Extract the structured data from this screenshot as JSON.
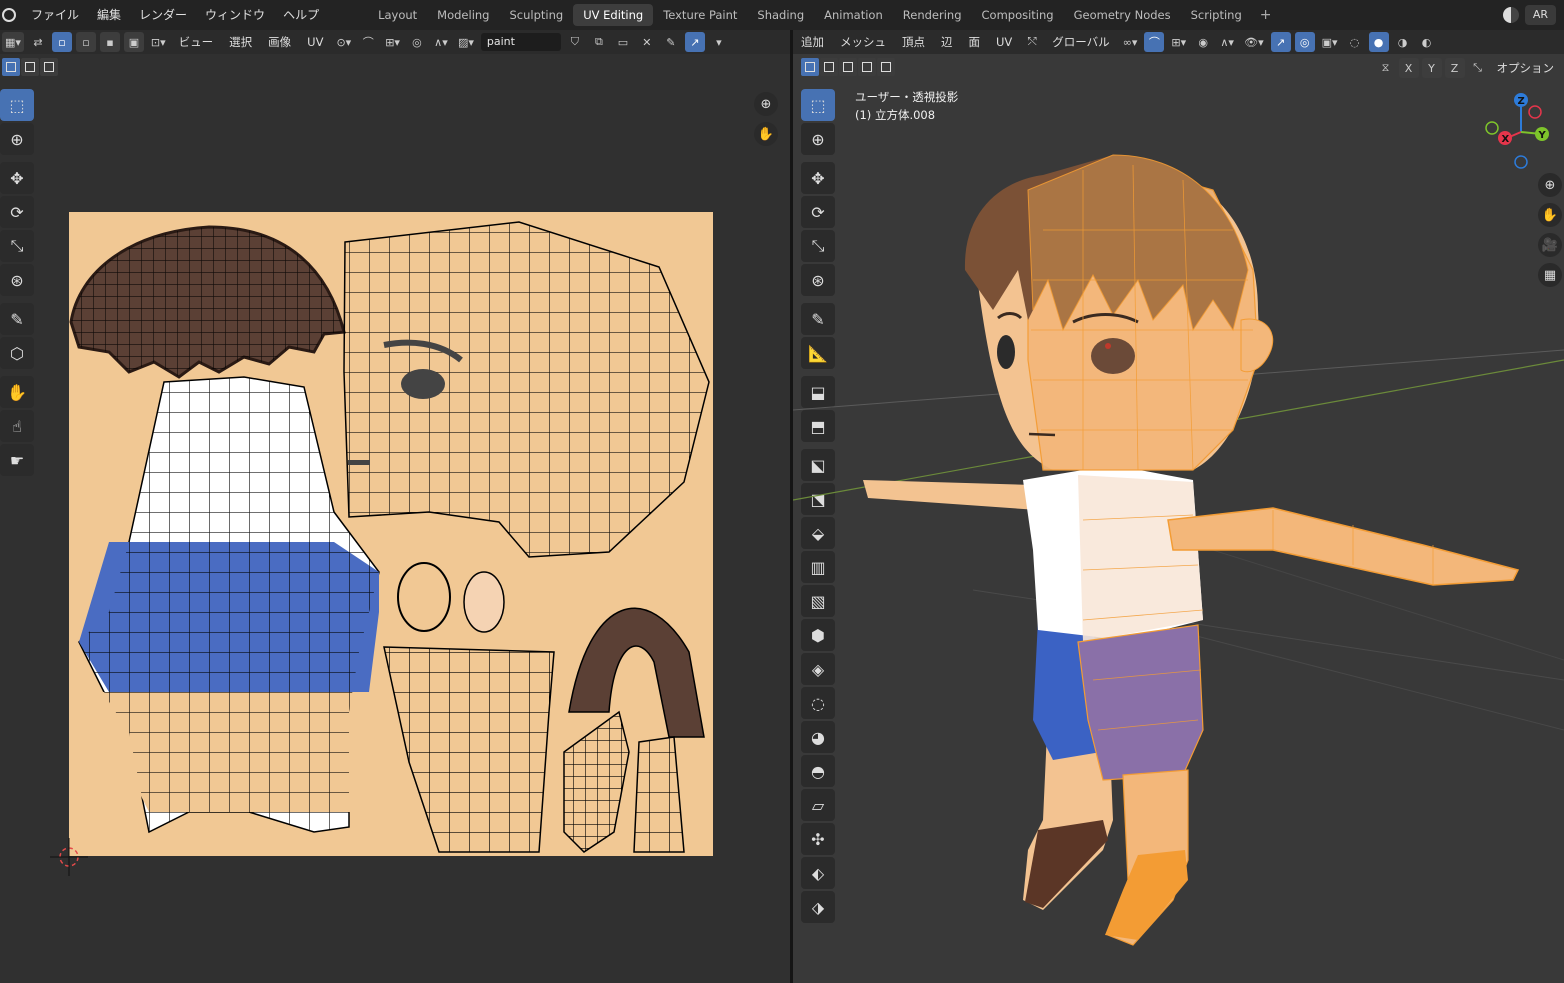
{
  "topbar": {
    "menus": [
      "ファイル",
      "編集",
      "レンダー",
      "ウィンドウ",
      "ヘルプ"
    ],
    "tabs": [
      "Layout",
      "Modeling",
      "Sculpting",
      "UV Editing",
      "Texture Paint",
      "Shading",
      "Animation",
      "Rendering",
      "Compositing",
      "Geometry Nodes",
      "Scripting"
    ],
    "active_tab": "UV Editing",
    "add_tab": "+",
    "right_label": "AR"
  },
  "uv_editor": {
    "menus": [
      "ビュー",
      "選択",
      "画像",
      "UV"
    ],
    "image_name": "paint",
    "colors": {
      "canvas": "#f1c894",
      "hair": "#5b4035",
      "shirt": "#ffffff",
      "shorts": "#4a6cc2",
      "wire": "#000000"
    }
  },
  "view3d": {
    "menus": [
      "追加",
      "メッシュ",
      "頂点",
      "辺",
      "面",
      "UV"
    ],
    "orientation": "グローバル",
    "options_label": "オプション",
    "axis_toggles": [
      "X",
      "Y",
      "Z"
    ],
    "view_name": "ユーザー・透視投影",
    "object_name": "(1) 立方体.008",
    "gizmo": {
      "x_label": "X",
      "y_label": "Y",
      "z_label": "Z",
      "x_color": "#e5354b",
      "y_color": "#7ec42b",
      "z_color": "#2d7bd9"
    },
    "colors": {
      "selection": "#f39c34",
      "skin": "#f3c391",
      "hair": "#7b5136",
      "shorts": "#3b62c4",
      "shoe": "#5b3626"
    }
  }
}
